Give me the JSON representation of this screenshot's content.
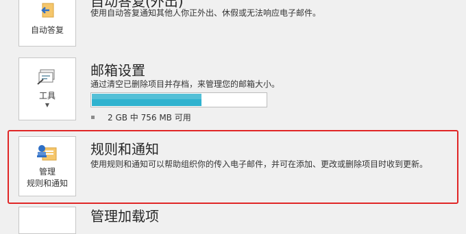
{
  "auto_reply": {
    "button_label": "自动答复",
    "heading": "自动答复(外出)",
    "description": "使用自动答复通知其他人你正外出、休假或无法响应电子邮件。"
  },
  "mailbox": {
    "button_label": "工具",
    "heading": "邮箱设置",
    "description": "通过清空已删除项目并存档，来管理您的邮箱大小。",
    "usage_fraction": 0.63,
    "quota_text": "2 GB 中 756 MB 可用"
  },
  "rules": {
    "button_label_line1": "管理",
    "button_label_line2": "规则和通知",
    "heading": "规则和通知",
    "description": "使用规则和通知可以帮助组织你的传入电子邮件，并可在添加、更改或删除项目时收到更新。"
  },
  "addins": {
    "heading": "管理加载项"
  },
  "colors": {
    "highlight": "#e02424",
    "bar_fill": "#2fb2cf"
  }
}
